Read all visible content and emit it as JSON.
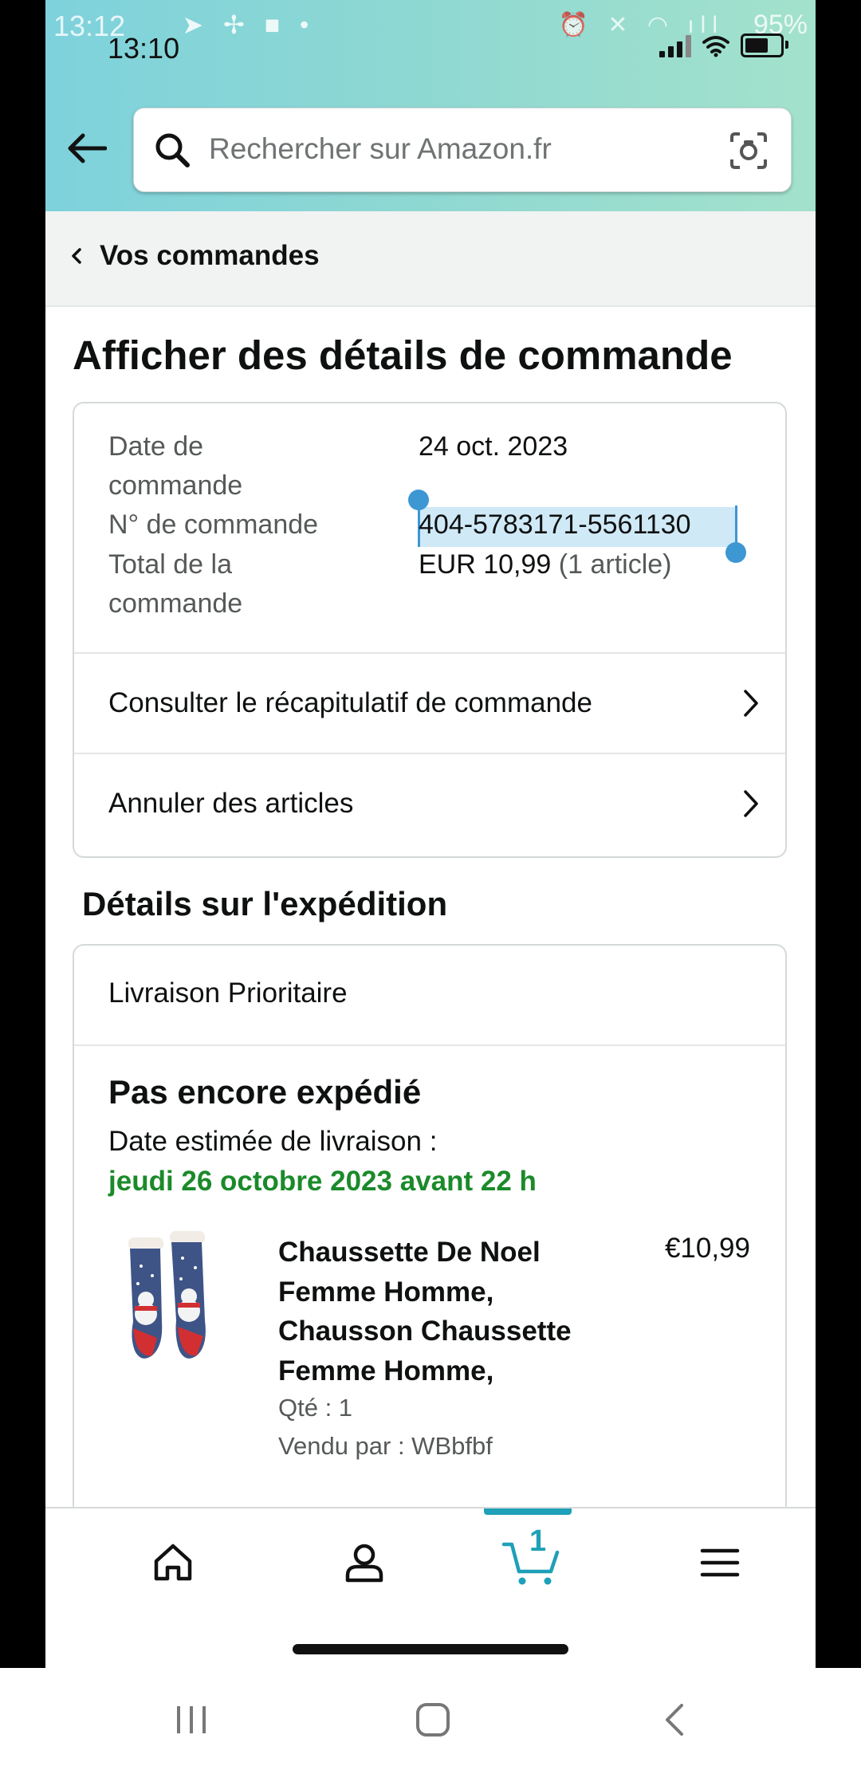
{
  "status_bar": {
    "outer_time": "13:12",
    "inner_time": "13:10",
    "outer_battery": "95%"
  },
  "search": {
    "placeholder": "Rechercher sur Amazon.fr"
  },
  "breadcrumb": {
    "label": "Vos commandes"
  },
  "page_title": "Afficher des détails de commande",
  "order": {
    "date_label": "Date de commande",
    "date_value": "24 oct. 2023",
    "number_label": "N° de commande",
    "number_value": "404-5783171-5561130",
    "total_label": "Total de la commande",
    "total_value": "EUR 10,99",
    "total_items": "(1 article)"
  },
  "links": {
    "summary": "Consulter le récapitulatif de commande",
    "cancel": "Annuler des articles"
  },
  "shipping": {
    "section_title": "Détails sur l'expédition",
    "type": "Livraison Prioritaire",
    "status": "Pas encore expédié",
    "estimate_label": "Date estimée de livraison :",
    "estimate_date": "jeudi 26 octobre 2023 avant 22 h"
  },
  "product": {
    "title": "Chaussette De Noel Femme Homme, Chausson Chaussette Femme Homme,",
    "price": "€10,99",
    "qty": "Qté : 1",
    "seller": "Vendu par : WBbfbf"
  },
  "bottom_nav": {
    "cart_count": "1",
    "items": [
      "home-icon",
      "account-icon",
      "cart-icon",
      "menu-icon"
    ]
  },
  "colors": {
    "header_gradient_start": "#7ed2dc",
    "header_gradient_end": "#a3e2cc",
    "delivery_green": "#1b8a2a",
    "cart_teal": "#1ea0b8",
    "selection_blue": "#3d97d3"
  }
}
